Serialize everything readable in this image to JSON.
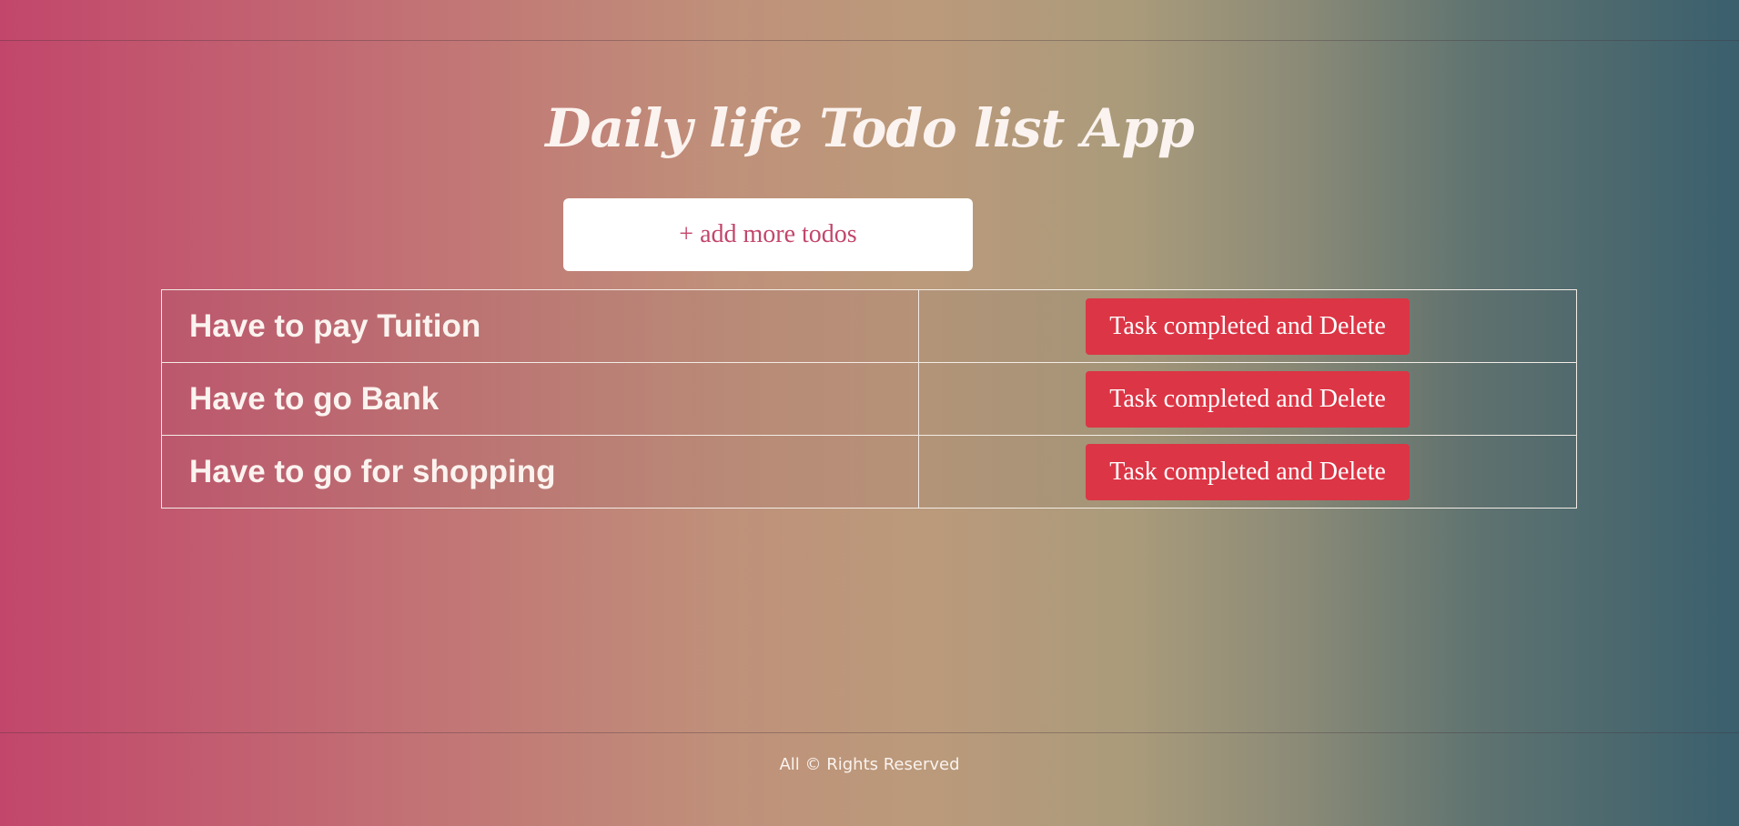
{
  "app": {
    "title": "Daily life Todo list App"
  },
  "add_button": {
    "label": "+ add more todos"
  },
  "todos": [
    {
      "text": "Have to pay Tuition",
      "action_label": "Task completed and Delete"
    },
    {
      "text": "Have to go Bank",
      "action_label": "Task completed and Delete"
    },
    {
      "text": "Have to go for shopping",
      "action_label": "Task completed and Delete"
    }
  ],
  "footer": {
    "text": "All © Rights Reserved"
  },
  "colors": {
    "accent": "#c2466b",
    "delete_button": "#dc3545",
    "text_light": "#fbf3ef",
    "gradient_start": "#c2466b",
    "gradient_end": "#3a5f6d"
  }
}
